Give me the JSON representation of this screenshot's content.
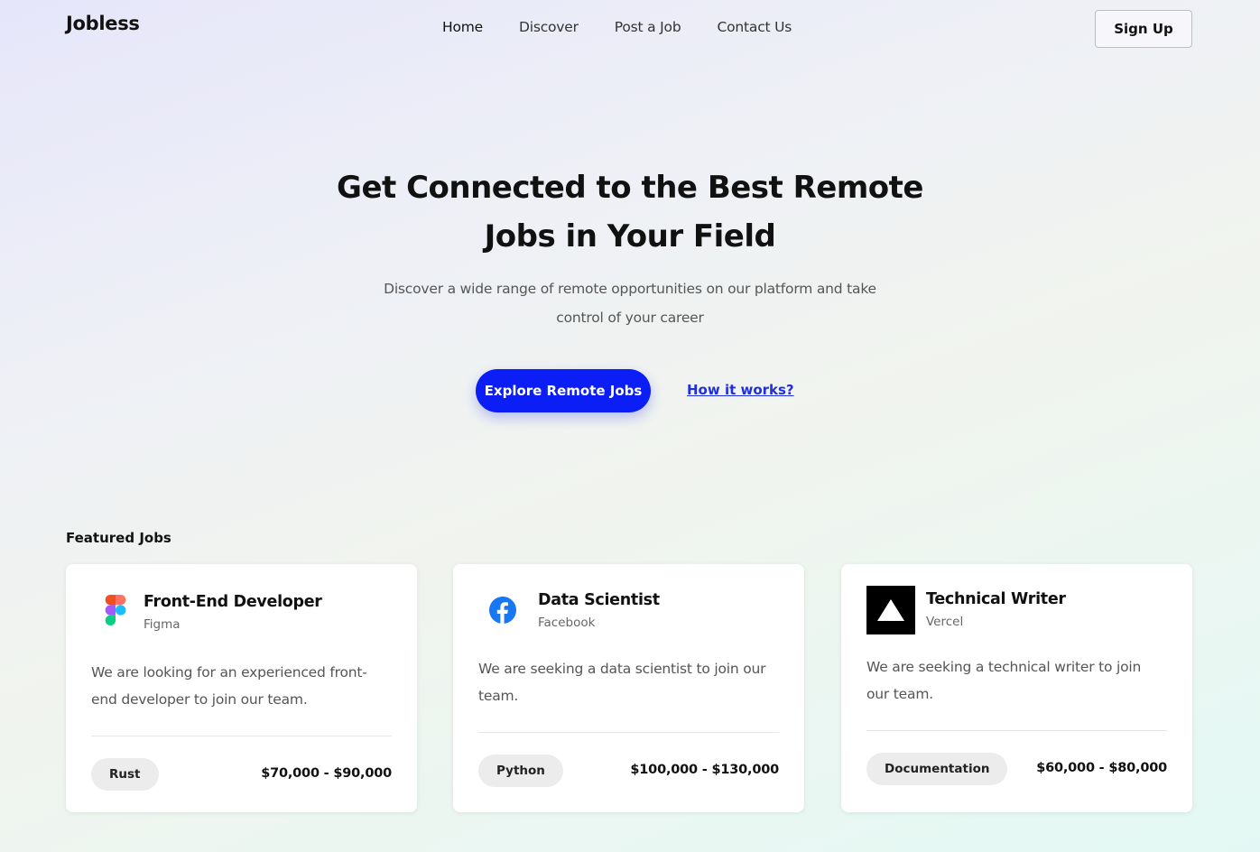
{
  "header": {
    "logo": "Jobless",
    "nav": [
      "Home",
      "Discover",
      "Post a Job",
      "Contact Us"
    ],
    "signup_label": "Sign Up"
  },
  "hero": {
    "title": "Get Connected to the Best Remote Jobs in Your Field",
    "subtitle": "Discover a wide range of remote opportunities on our platform and take control of your career",
    "cta_label": "Explore Remote Jobs",
    "how_label": "How it works?"
  },
  "featured": {
    "label": "Featured Jobs",
    "jobs": [
      {
        "title": "Front-End Developer",
        "company": "Figma",
        "icon": "figma-icon",
        "description": "We are looking for an experienced front-end developer to join our team.",
        "tag": "Rust",
        "salary": "$70,000 - $90,000"
      },
      {
        "title": "Data Scientist",
        "company": "Facebook",
        "icon": "facebook-icon",
        "description": "We are seeking a data scientist to join our team.",
        "tag": "Python",
        "salary": "$100,000 - $130,000"
      },
      {
        "title": "Technical Writer",
        "company": "Vercel",
        "icon": "vercel-icon",
        "description": "We are seeking a technical writer to join our team.",
        "tag": "Documentation",
        "salary": "$60,000 - $80,000"
      }
    ]
  },
  "colors": {
    "primary": "#0a1ef5",
    "link": "#1d2fe0",
    "facebook": "#1877f2"
  }
}
